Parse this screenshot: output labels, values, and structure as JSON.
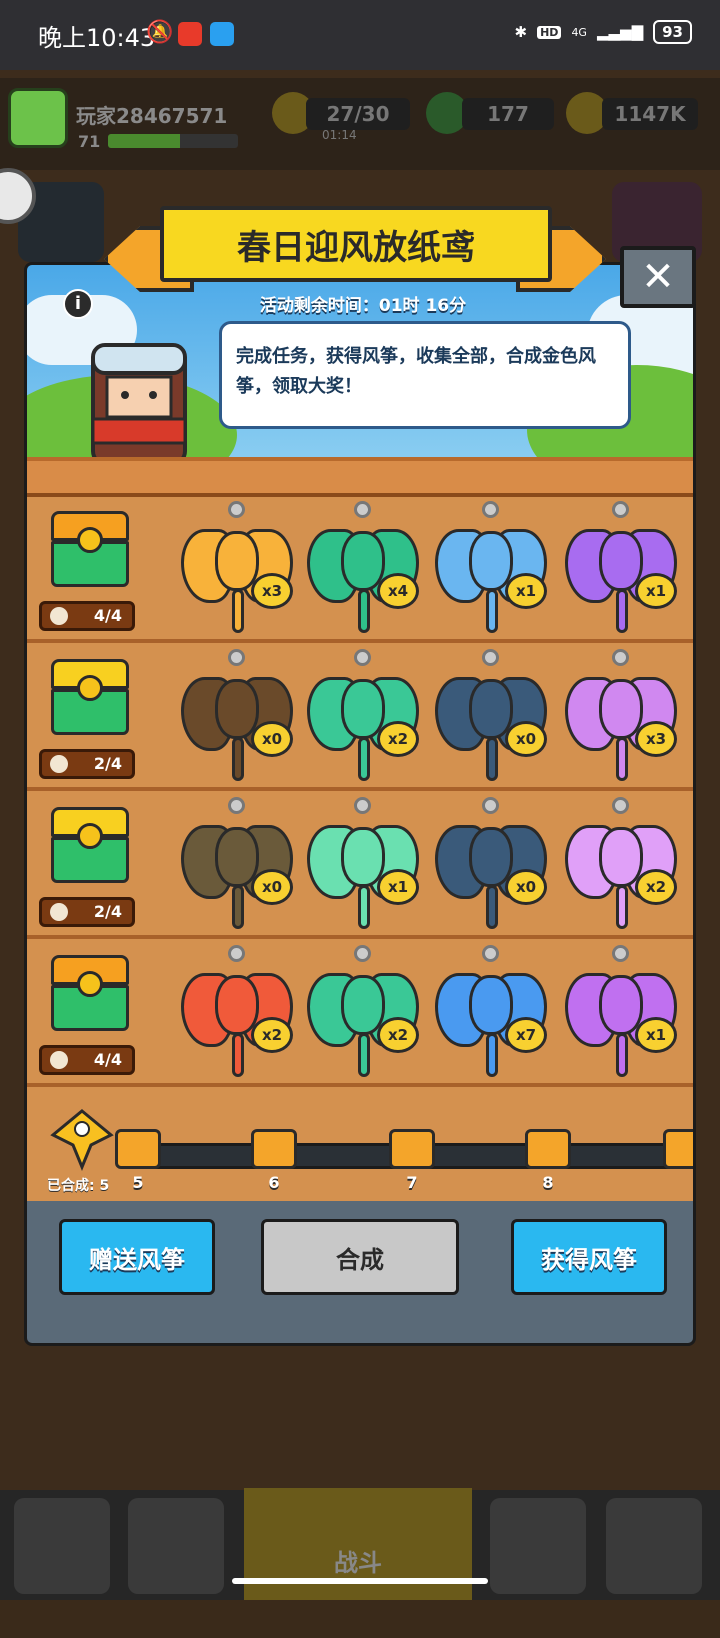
{
  "status_bar": {
    "time": "晚上10:43",
    "network": "4G",
    "battery": "93",
    "hd": "HD"
  },
  "player": {
    "name": "玩家28467571",
    "level": "71",
    "xp_fraction": 0.55
  },
  "resources": {
    "energy": "27/30",
    "energy_timer": "01:14",
    "gems": "177",
    "coins": "1147K"
  },
  "event": {
    "title": "春日迎风放纸鸢",
    "timer": "活动剩余时间：01时 16分",
    "description": "完成任务，获得风筝，收集全部，合成金色风筝，领取大奖！",
    "close_label": "✕",
    "info_label": "i"
  },
  "rows": [
    {
      "progress": "4/4",
      "chest_color": "#f6a020",
      "kites": [
        {
          "color": "#f8b23a",
          "count": "x3"
        },
        {
          "color": "#2fc08a",
          "count": "x4"
        },
        {
          "color": "#6ab6f0",
          "count": "x1"
        },
        {
          "color": "#a86cf0",
          "count": "x1"
        }
      ]
    },
    {
      "progress": "2/4",
      "chest_color": "#f8d020",
      "kites": [
        {
          "color": "#6a4a2a",
          "count": "x0"
        },
        {
          "color": "#3ac896",
          "count": "x2"
        },
        {
          "color": "#3a5a7a",
          "count": "x0"
        },
        {
          "color": "#d088f0",
          "count": "x3"
        }
      ]
    },
    {
      "progress": "2/4",
      "chest_color": "#f8d020",
      "kites": [
        {
          "color": "#6a5a3a",
          "count": "x0"
        },
        {
          "color": "#6ae0b0",
          "count": "x1"
        },
        {
          "color": "#3a5a7a",
          "count": "x0"
        },
        {
          "color": "#e0a0f8",
          "count": "x2"
        }
      ]
    },
    {
      "progress": "4/4",
      "chest_color": "#f6a020",
      "kites": [
        {
          "color": "#f05a3a",
          "count": "x2"
        },
        {
          "color": "#3ac896",
          "count": "x2"
        },
        {
          "color": "#4a9af0",
          "count": "x7"
        },
        {
          "color": "#c070f0",
          "count": "x1"
        }
      ]
    }
  ],
  "milestones": [
    "5",
    "6",
    "7",
    "8"
  ],
  "merged_label": "已合成: 5",
  "buttons": {
    "gift": "赠送风筝",
    "merge": "合成",
    "get": "获得风筝"
  },
  "nav": {
    "fight": "战斗"
  },
  "icons": [
    "bell-off-icon",
    "bluetooth-icon",
    "signal-icon",
    "energy-icon",
    "gem-icon",
    "coin-icon",
    "chest-icon",
    "close-icon",
    "info-icon",
    "kite-icon"
  ]
}
